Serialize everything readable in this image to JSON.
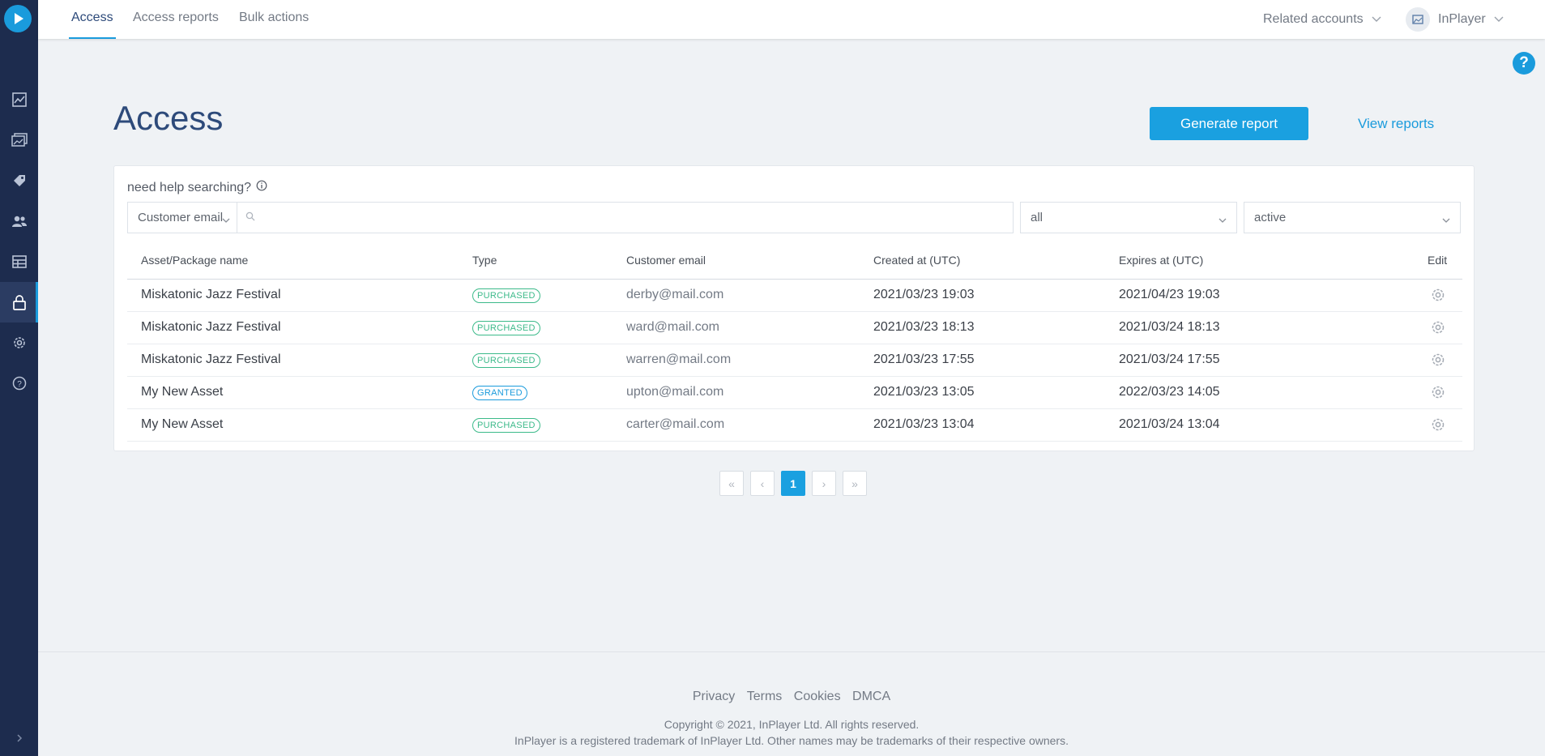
{
  "topbar": {
    "tabs": [
      {
        "label": "Access",
        "active": true
      },
      {
        "label": "Access reports",
        "active": false
      },
      {
        "label": "Bulk actions",
        "active": false
      }
    ],
    "related_accounts": "Related accounts",
    "account_name": "InPlayer"
  },
  "sidebar": {
    "items": [
      {
        "icon": "analytics-icon"
      },
      {
        "icon": "assets-icon"
      },
      {
        "icon": "pricing-tag-icon"
      },
      {
        "icon": "audience-icon"
      },
      {
        "icon": "reports-table-icon"
      },
      {
        "icon": "lock-icon",
        "active": true
      },
      {
        "icon": "settings-gear-icon"
      },
      {
        "icon": "help-circle-icon"
      }
    ]
  },
  "help_button": "?",
  "page": {
    "title": "Access",
    "generate_report": "Generate report",
    "view_reports": "View reports"
  },
  "search": {
    "help_text": "need help searching?",
    "field_select": "Customer email",
    "query": "",
    "type_filter": "all",
    "status_filter": "active"
  },
  "table": {
    "headers": {
      "asset": "Asset/Package name",
      "type": "Type",
      "email": "Customer email",
      "created": "Created at (UTC)",
      "expires": "Expires at (UTC)",
      "edit": "Edit"
    },
    "rows": [
      {
        "asset": "Miskatonic Jazz Festival",
        "type": "PURCHASED",
        "email": "derby@mail.com",
        "created": "2021/03/23 19:03",
        "expires": "2021/04/23 19:03"
      },
      {
        "asset": "Miskatonic Jazz Festival",
        "type": "PURCHASED",
        "email": "ward@mail.com",
        "created": "2021/03/23 18:13",
        "expires": "2021/03/24 18:13"
      },
      {
        "asset": "Miskatonic Jazz Festival",
        "type": "PURCHASED",
        "email": "warren@mail.com",
        "created": "2021/03/23 17:55",
        "expires": "2021/03/24 17:55"
      },
      {
        "asset": "My New Asset",
        "type": "GRANTED",
        "email": "upton@mail.com",
        "created": "2021/03/23 13:05",
        "expires": "2022/03/23 14:05"
      },
      {
        "asset": "My New Asset",
        "type": "PURCHASED",
        "email": "carter@mail.com",
        "created": "2021/03/23 13:04",
        "expires": "2021/03/24 13:04"
      }
    ]
  },
  "pagination": {
    "first": "«",
    "prev": "‹",
    "current": "1",
    "next": "›",
    "last": "»"
  },
  "footer": {
    "links": [
      "Privacy",
      "Terms",
      "Cookies",
      "DMCA"
    ],
    "copyright": "Copyright © 2021, InPlayer Ltd. All rights reserved.",
    "trademark": "InPlayer is a registered trademark of InPlayer Ltd. Other names may be trademarks of their respective owners."
  },
  "colors": {
    "sidebar": "#1d2c4e",
    "accent": "#1aa0e0",
    "title": "#2d4a7a",
    "purchased": "#3cba8a",
    "granted": "#1a9bdc"
  }
}
